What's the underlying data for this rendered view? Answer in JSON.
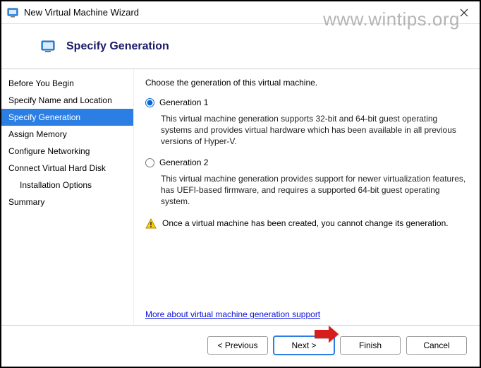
{
  "window": {
    "title": "New Virtual Machine Wizard"
  },
  "watermark": "www.wintips.org",
  "header": {
    "title": "Specify Generation"
  },
  "sidebar": {
    "steps": [
      "Before You Begin",
      "Specify Name and Location",
      "Specify Generation",
      "Assign Memory",
      "Configure Networking",
      "Connect Virtual Hard Disk",
      "Installation Options",
      "Summary"
    ],
    "active_index": 2,
    "indent_index": 6
  },
  "content": {
    "prompt": "Choose the generation of this virtual machine.",
    "options": [
      {
        "label": "Generation 1",
        "desc": "This virtual machine generation supports 32-bit and 64-bit guest operating systems and provides virtual hardware which has been available in all previous versions of Hyper-V.",
        "selected": true
      },
      {
        "label": "Generation 2",
        "desc": "This virtual machine generation provides support for newer virtualization features, has UEFI-based firmware, and requires a supported 64-bit guest operating system.",
        "selected": false
      }
    ],
    "warning": "Once a virtual machine has been created, you cannot change its generation.",
    "link": "More about virtual machine generation support"
  },
  "footer": {
    "previous": "< Previous",
    "next": "Next >",
    "finish": "Finish",
    "cancel": "Cancel"
  }
}
